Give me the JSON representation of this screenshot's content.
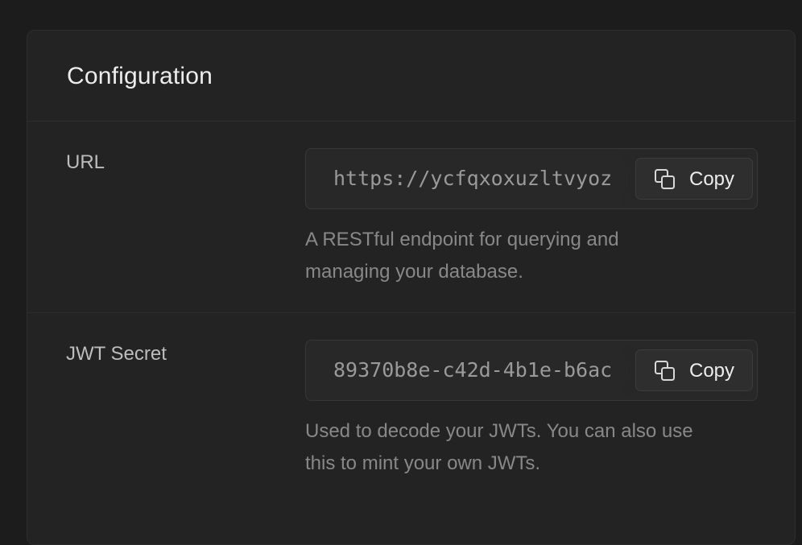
{
  "panel": {
    "title": "Configuration"
  },
  "url_row": {
    "label": "URL",
    "value": "https://ycfqxoxuzltvyoz",
    "copy_label": "Copy",
    "help_line1": "A RESTful endpoint for querying and",
    "help_line2": "managing your database."
  },
  "jwt_row": {
    "label": "JWT Secret",
    "value": "89370b8e-c42d-4b1e-b6ac",
    "copy_label": "Copy",
    "help_line1": "Used to decode your JWTs. You can also use",
    "help_line2": "this to mint your own JWTs."
  },
  "icons": {
    "copy": "copy-icon"
  },
  "colors": {
    "background": "#1c1c1c",
    "panel": "#232323",
    "border": "#2e2e2e",
    "text_primary": "#ededed",
    "text_muted": "#888888"
  }
}
